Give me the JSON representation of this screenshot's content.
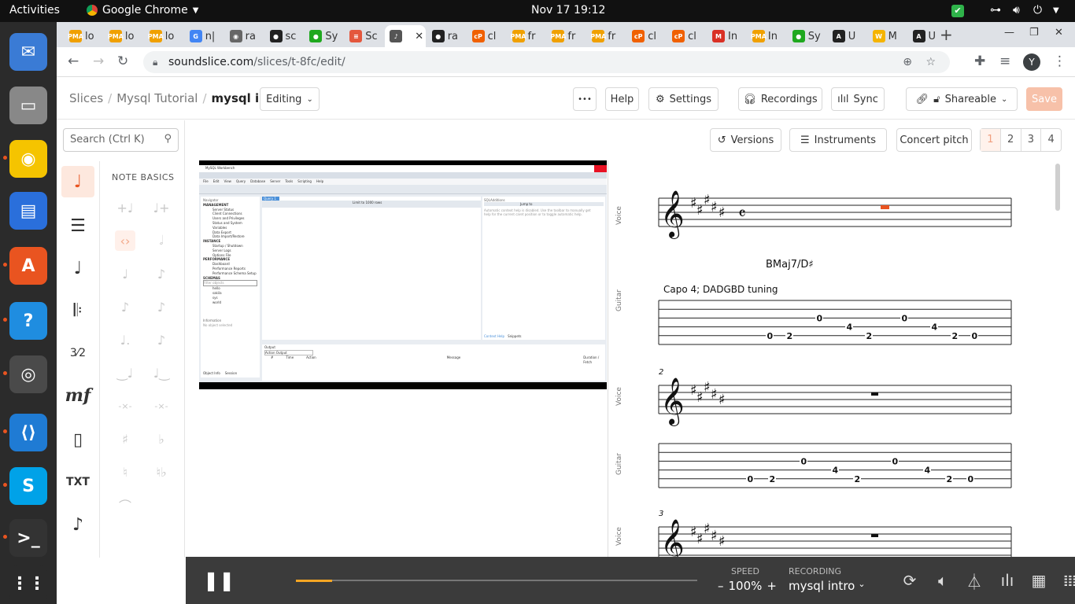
{
  "topbar": {
    "activities": "Activities",
    "app": "Google Chrome",
    "clock": "Nov 17  19:12"
  },
  "dock": [
    {
      "name": "thunderbird-icon",
      "color": "#3a7bd5"
    },
    {
      "name": "files-icon",
      "color": "#888"
    },
    {
      "name": "rhythmbox-icon",
      "color": "#f5c400"
    },
    {
      "name": "writer-icon",
      "color": "#2a6fdb"
    },
    {
      "name": "software-icon",
      "color": "#e95420"
    },
    {
      "name": "help-icon",
      "color": "#1f8de0"
    },
    {
      "name": "chrome-icon",
      "color": "#4a4a4a"
    },
    {
      "name": "vscode-icon",
      "color": "#1f7bd4"
    },
    {
      "name": "skype-icon",
      "color": "#00a2e8"
    },
    {
      "name": "terminal-icon",
      "color": "#333"
    },
    {
      "name": "apps-grid-icon",
      "color": "#2b2b2b"
    }
  ],
  "tabs": [
    {
      "label": "lo",
      "fav": "PMA",
      "color": "#f0a000"
    },
    {
      "label": "lo",
      "fav": "PMA",
      "color": "#f0a000"
    },
    {
      "label": "lo",
      "fav": "PMA",
      "color": "#f0a000"
    },
    {
      "label": "n|",
      "fav": "G",
      "color": "#4285f4"
    },
    {
      "label": "ra",
      "fav": "◉",
      "color": "#666"
    },
    {
      "label": "sc",
      "fav": "●",
      "color": "#222"
    },
    {
      "label": "Sy",
      "fav": "●",
      "color": "#1fa81f"
    },
    {
      "label": "Sc",
      "fav": "≡",
      "color": "#e4573d"
    },
    {
      "label": "",
      "fav": "♪",
      "color": "#555",
      "active": true
    },
    {
      "label": "ra",
      "fav": "●",
      "color": "#222"
    },
    {
      "label": "cl",
      "fav": "cP",
      "color": "#f06000"
    },
    {
      "label": "fr",
      "fav": "PMA",
      "color": "#f0a000"
    },
    {
      "label": "fr",
      "fav": "PMA",
      "color": "#f0a000"
    },
    {
      "label": "fr",
      "fav": "PMA",
      "color": "#f0a000"
    },
    {
      "label": "cl",
      "fav": "cP",
      "color": "#f06000"
    },
    {
      "label": "cl",
      "fav": "cP",
      "color": "#f06000"
    },
    {
      "label": "In",
      "fav": "M",
      "color": "#d93025"
    },
    {
      "label": "In",
      "fav": "PMA",
      "color": "#f0a000"
    },
    {
      "label": "Sy",
      "fav": "●",
      "color": "#1fa81f"
    },
    {
      "label": "U",
      "fav": "A",
      "color": "#222"
    },
    {
      "label": "M",
      "fav": "W",
      "color": "#f5b400"
    },
    {
      "label": "U",
      "fav": "A",
      "color": "#222"
    }
  ],
  "url": {
    "host": "soundslice.com",
    "path": "/slices/t-8fc/edit/"
  },
  "header": {
    "crumbs": [
      "Slices",
      "/",
      "Mysql Tutorial",
      "/",
      "mysql intro"
    ],
    "mode": "Editing",
    "more": "•••",
    "help": "Help",
    "settings": "Settings",
    "recordings": "Recordings",
    "sync": "Sync",
    "shareable": "Shareable",
    "save": "Save"
  },
  "subbar": {
    "versions": "Versions",
    "instruments": "Instruments",
    "concert": "Concert pitch",
    "pages": [
      "1",
      "2",
      "3",
      "4"
    ]
  },
  "sidebar": {
    "search": "Search (Ctrl K)",
    "section": "NOTE BASICS",
    "txt": "TXT"
  },
  "score": {
    "voice": "Voice",
    "guitar": "Guitar",
    "chord": "BMaj7/D♯",
    "capo": "Capo 4; DADGBD tuning",
    "m2": "2",
    "m3": "3",
    "tab1": [
      [
        "0",
        "2",
        "0",
        "2",
        "0",
        "4",
        "4",
        "0",
        "2",
        "0"
      ]
    ]
  },
  "workbench": {
    "title": "MySQL Workbench",
    "menu": [
      "File",
      "Edit",
      "View",
      "Query",
      "Database",
      "Server",
      "Tools",
      "Scripting",
      "Help"
    ],
    "nav": "Navigator",
    "management": "MANAGEMENT",
    "mgmt": [
      "Server Status",
      "Client Connections",
      "Users and Privileges",
      "Status and System Variables",
      "Data Export",
      "Data Import/Restore"
    ],
    "instance": "INSTANCE",
    "inst": [
      "Startup / Shutdown",
      "Server Logs",
      "Options File"
    ],
    "performance": "PERFORMANCE",
    "perf": [
      "Dashboard",
      "Performance Reports",
      "Performance Schema Setup"
    ],
    "schemas": "SCHEMAS",
    "filter": "Filter objects",
    "dbs": [
      "hello",
      "sakila",
      "sys",
      "world"
    ],
    "info": "Information",
    "noobj": "No object selected",
    "query": "Query 1",
    "sqladd": "SQLAdditions",
    "limit": "Limit to 1000 rows",
    "jump": "Jump to",
    "help": "Automatic context help is disabled. Use the toolbar to manually get help for the current caret position or to toggle automatic help.",
    "output": "Output",
    "action": "Action Output",
    "cols": [
      "#",
      "Time",
      "Action",
      "Message",
      "Duration / Fetch"
    ],
    "ctx": "Context Help",
    "snip": "Snippets",
    "objinfo": "Object Info",
    "session": "Session"
  },
  "player": {
    "speed_label": "SPEED",
    "speed": "100%",
    "minus": "–",
    "plus": "+",
    "rec_label": "RECORDING",
    "rec": "mysql intro",
    "progress": 0.09
  }
}
